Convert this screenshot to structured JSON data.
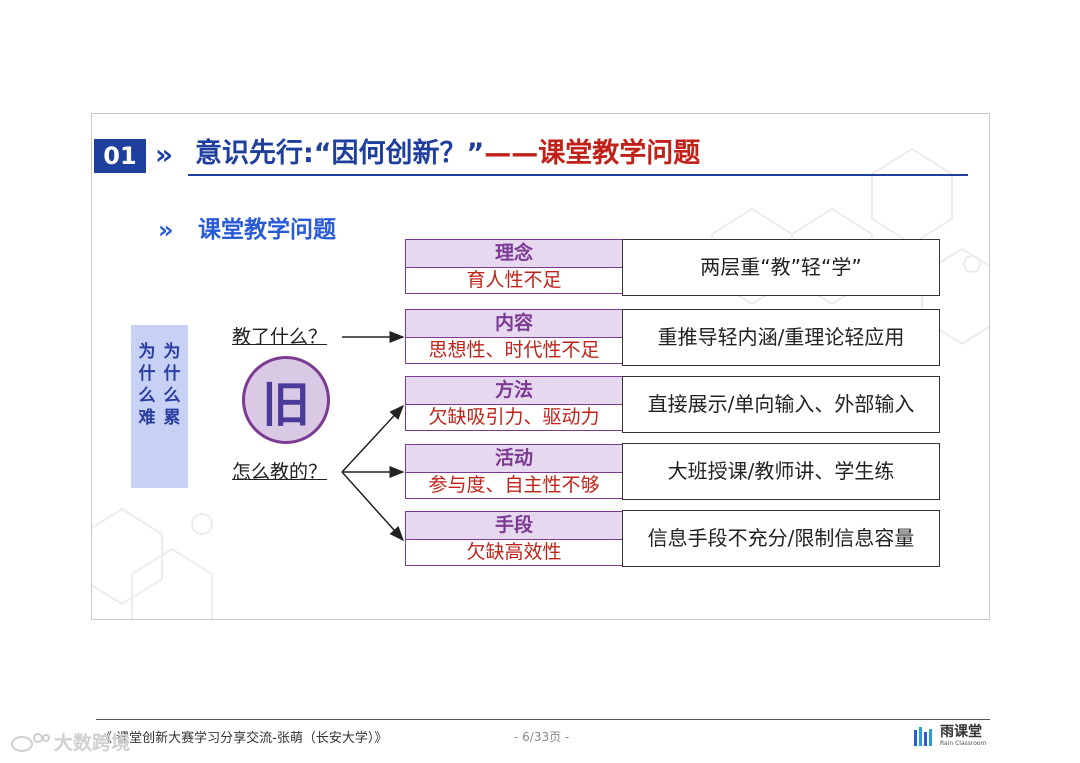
{
  "header": {
    "number": "01",
    "chevron": "»",
    "title_blue": "意识先行:“因何创新？”",
    "title_red": "——课堂教学问题",
    "accent": "#1f3f9e",
    "accent_red": "#c0221a"
  },
  "subtitle": {
    "chevron": "»",
    "text": "课堂教学问题"
  },
  "left_box": {
    "col_right": "为什么累",
    "col_left": "为什么难"
  },
  "questions": {
    "q1": "教了什么？",
    "q2": "怎么教的？"
  },
  "circle": {
    "char": "旧"
  },
  "rows": [
    {
      "title": "理念",
      "issue": "育人性不足",
      "desc": "两层重“教”轻“学”"
    },
    {
      "title": "内容",
      "issue": "思想性、时代性不足",
      "desc": "重推导轻内涵/重理论轻应用"
    },
    {
      "title": "方法",
      "issue": "欠缺吸引力、驱动力",
      "desc": "直接展示/单向输入、外部输入"
    },
    {
      "title": "活动",
      "issue": "参与度、自主性不够",
      "desc": "大班授课/教师讲、学生练"
    },
    {
      "title": "手段",
      "issue": "欠缺高效性",
      "desc": "信息手段不充分/限制信息容量"
    }
  ],
  "footer": {
    "left": "《 课堂创新大赛学习分享交流-张萌（长安大学）》",
    "page": "- 6/33页 -",
    "logo_text": "雨课堂",
    "logo_sub": "Rain Classroom",
    "watermark": "大数跨境"
  },
  "icons": {
    "logo": "rain-classroom-logo-icon",
    "watermark": "weibo-icon"
  }
}
